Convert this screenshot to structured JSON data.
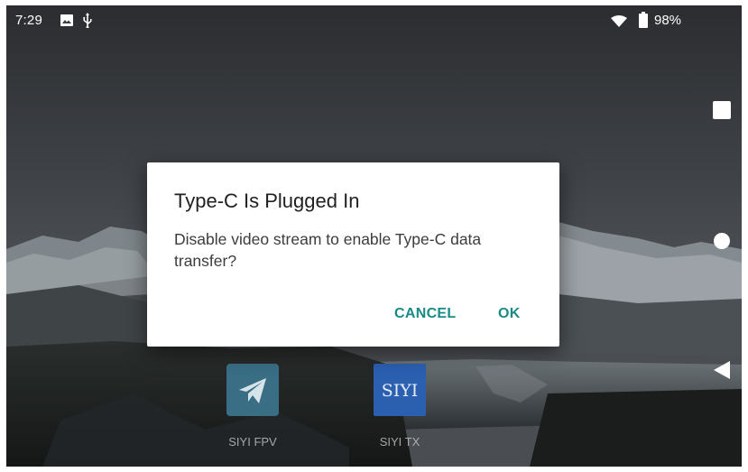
{
  "status_bar": {
    "time": "7:29",
    "battery_percent": "98%",
    "icons": [
      "image-icon",
      "usb-icon",
      "wifi-icon",
      "battery-icon"
    ]
  },
  "dialog": {
    "title": "Type-C Is Plugged In",
    "message": "Disable video stream to enable Type-C data transfer?",
    "cancel_label": "CANCEL",
    "ok_label": "OK"
  },
  "apps": [
    {
      "label": "SIYI FPV",
      "icon": "paper-plane-icon"
    },
    {
      "label": "SIYI TX",
      "icon_text": "SIYI"
    }
  ],
  "nav_bar": {
    "buttons": [
      "recents-button",
      "home-button",
      "back-button"
    ]
  },
  "colors": {
    "accent": "#1a8a86",
    "dialog_bg": "#ffffff",
    "siyi_tx_icon": "#2b5fb0",
    "siyi_fpv_icon": "#3a6e85"
  }
}
